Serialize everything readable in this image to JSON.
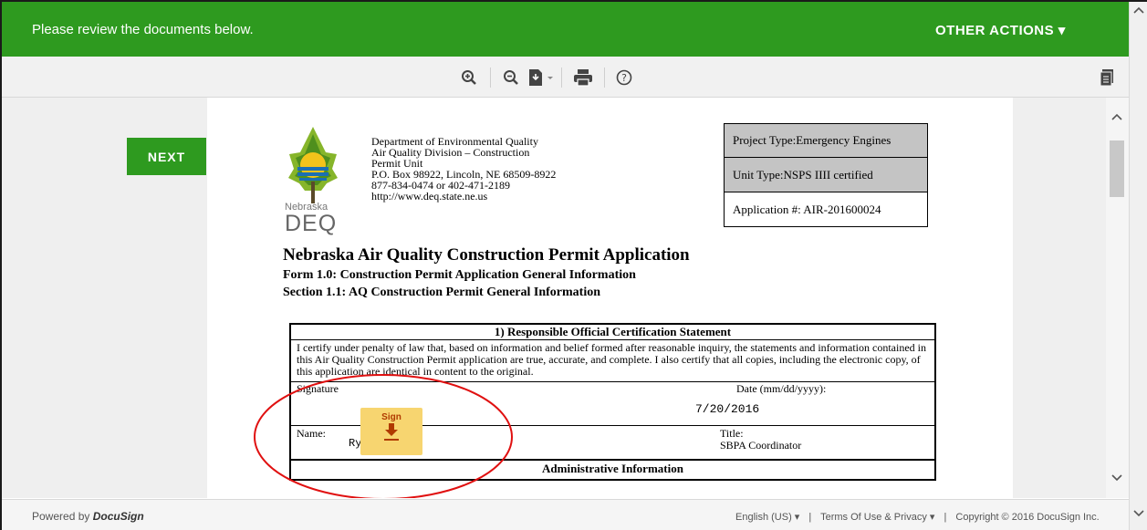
{
  "header": {
    "message": "Please review the documents below.",
    "other_actions": "OTHER ACTIONS ▾"
  },
  "toolbar": {
    "icons": [
      "zoom-in-icon",
      "zoom-out-icon",
      "download-icon",
      "print-icon",
      "help-icon",
      "documents-icon"
    ]
  },
  "navigation": {
    "next_label": "NEXT"
  },
  "document": {
    "org_lines": [
      "Department of Environmental Quality",
      "Air Quality Division – Construction",
      "Permit Unit",
      "P.O. Box 98922, Lincoln, NE 68509-8922",
      "877-834-0474 or 402-471-2189"
    ],
    "url": "http://www.deq.state.ne.us",
    "logo_state": "Nebraska",
    "logo_name": "DEQ",
    "project_type": "Project Type:Emergency Engines",
    "unit_type": "Unit Type:NSPS IIII certified",
    "application_no": "Application #:  AIR-201600024",
    "title": "Nebraska Air Quality Construction Permit Application",
    "form": "Form 1.0: Construction Permit Application General Information",
    "section": "Section 1.1: AQ Construction Permit General Information",
    "cert_header": "1) Responsible Official Certification Statement",
    "cert_statement": "I certify under penalty of law that, based on information and belief formed after reasonable inquiry, the statements and information contained in this Air Quality Construction Permit application are true, accurate, and complete.  I also certify that all copies, including the electronic copy, of this application are identical in content to the original.",
    "signature_label": "Signature",
    "date_label": "Date (mm/dd/yyyy):",
    "date_value": "7/20/2016",
    "name_label": "Name:",
    "name_value": "Ryan Green",
    "title_label": "Title:",
    "title_value": "SBPA Coordinator",
    "admin_header": "Administrative Information",
    "sign_tab_label": "Sign"
  },
  "footer": {
    "powered_by": "Powered by",
    "brand": "DocuSign",
    "language": "English (US) ▾",
    "terms": "Terms Of Use & Privacy ▾",
    "copyright": "Copyright © 2016 DocuSign Inc."
  },
  "colors": {
    "brand_green": "#2e9a1f",
    "sign_tab": "#f7d570",
    "annotation_circle": "#e01010"
  }
}
